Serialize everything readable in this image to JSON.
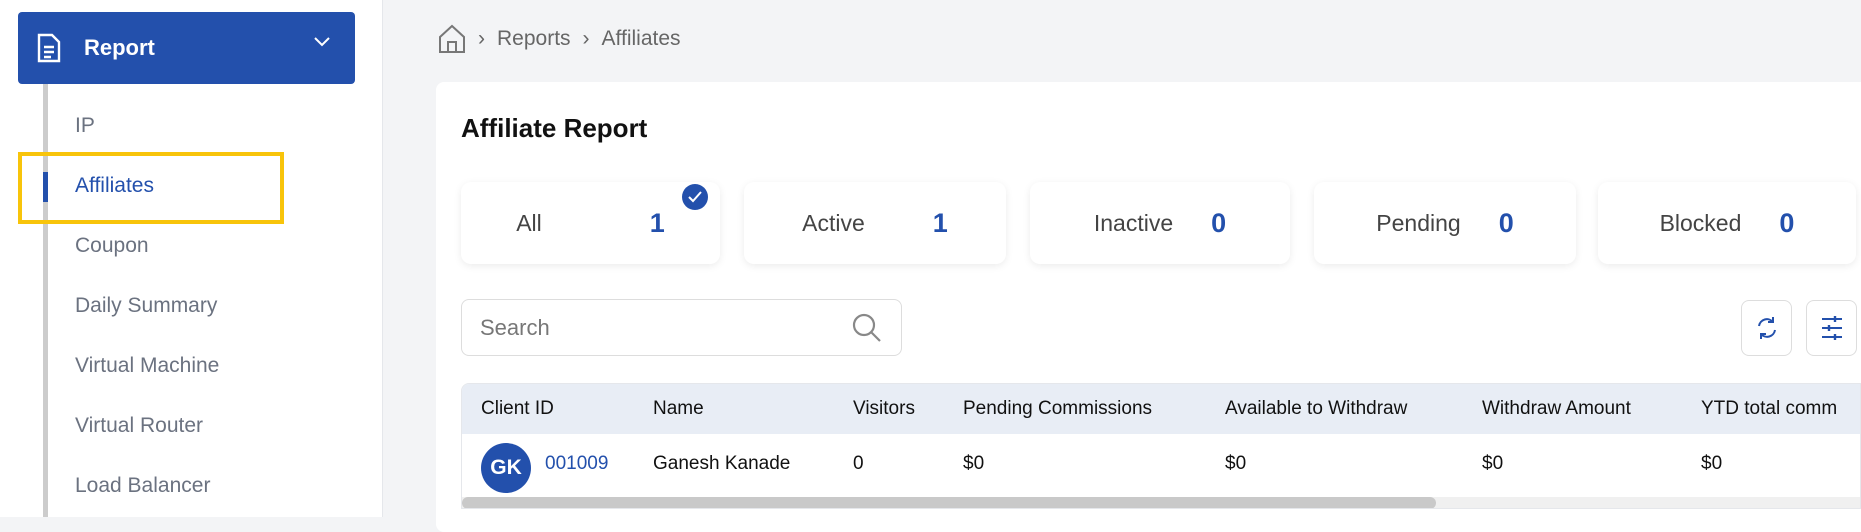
{
  "sidebar": {
    "section": "Report",
    "items": [
      {
        "label": "IP"
      },
      {
        "label": "Affiliates",
        "active": true
      },
      {
        "label": "Coupon"
      },
      {
        "label": "Daily Summary"
      },
      {
        "label": "Virtual Machine"
      },
      {
        "label": "Virtual Router"
      },
      {
        "label": "Load Balancer"
      }
    ]
  },
  "breadcrumb": [
    "Reports",
    "Affiliates"
  ],
  "page": {
    "title": "Affiliate Report"
  },
  "stats": [
    {
      "label": "All",
      "value": "1",
      "selected": true
    },
    {
      "label": "Active",
      "value": "1"
    },
    {
      "label": "Inactive",
      "value": "0"
    },
    {
      "label": "Pending",
      "value": "0"
    },
    {
      "label": "Blocked",
      "value": "0"
    }
  ],
  "search": {
    "placeholder": "Search",
    "value": ""
  },
  "table": {
    "columns": [
      "Client ID",
      "Name",
      "Visitors",
      "Pending Commissions",
      "Available to Withdraw",
      "Withdraw Amount",
      "YTD total comm"
    ],
    "rows": [
      {
        "initials": "GK",
        "client_id": "001009",
        "name": "Ganesh Kanade",
        "visitors": "0",
        "pending": "$0",
        "available": "$0",
        "withdraw": "$0",
        "ytd": "$0"
      }
    ]
  },
  "colors": {
    "accent": "#2350ac",
    "highlight": "#f8c40a"
  }
}
